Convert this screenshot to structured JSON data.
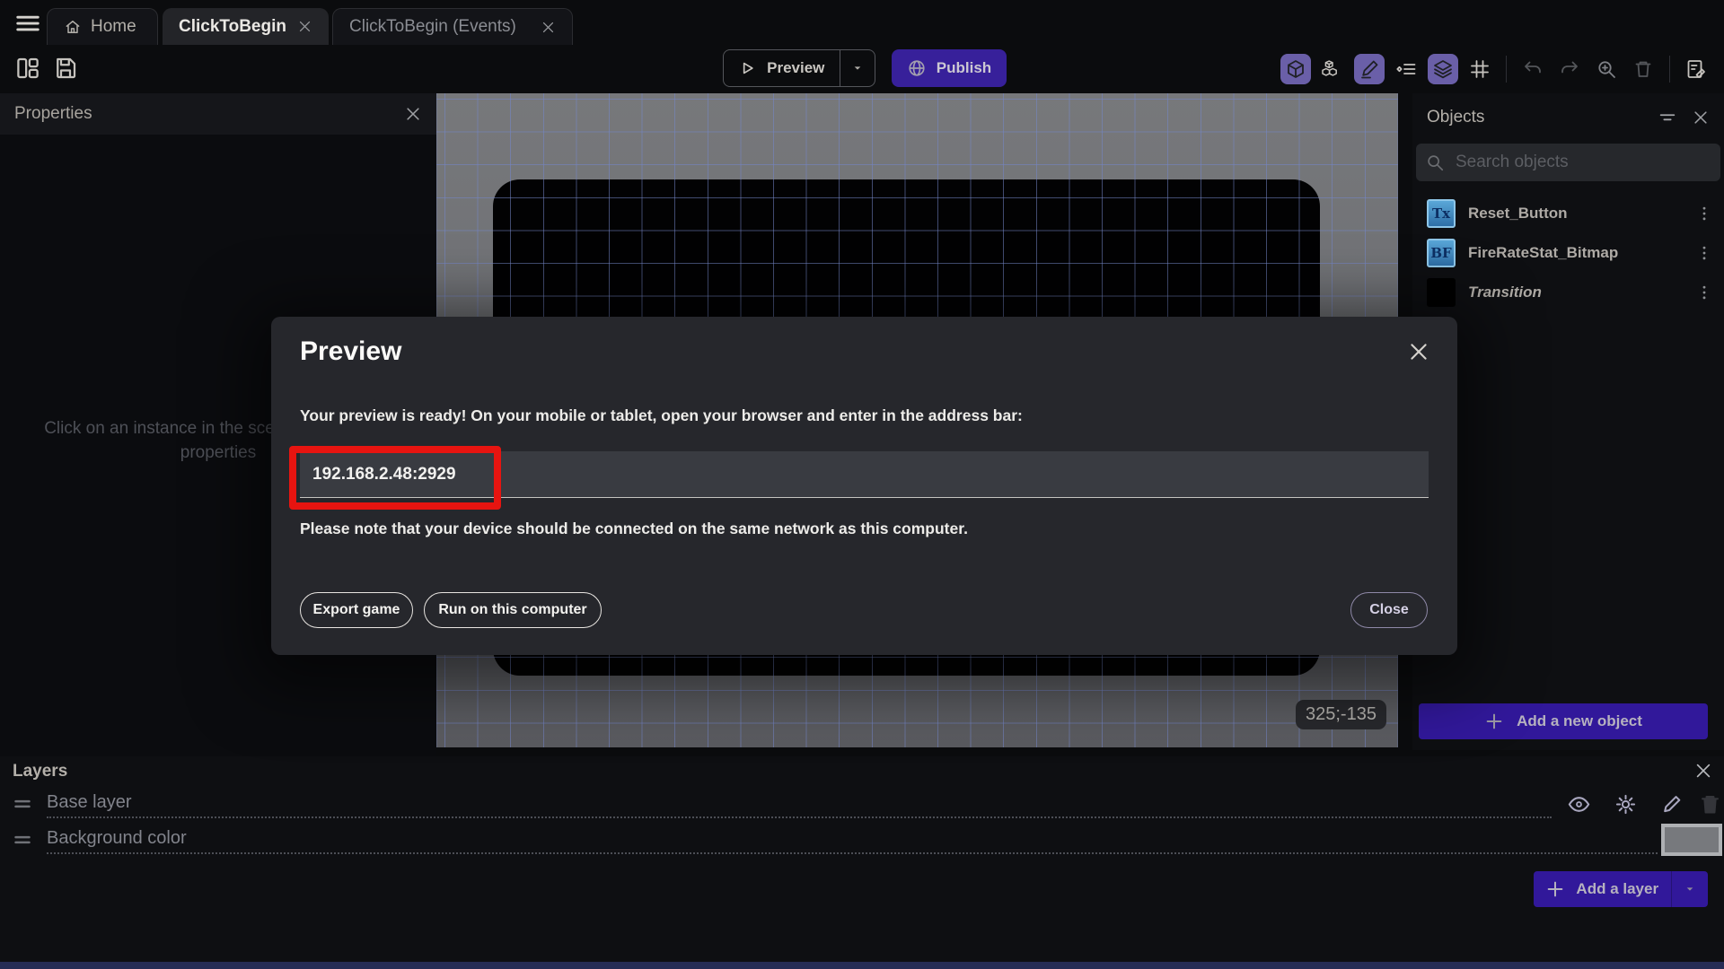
{
  "tab_bar": {
    "tabs": [
      {
        "label": "Home"
      },
      {
        "label": "ClickToBegin",
        "active": true
      },
      {
        "label": "ClickToBegin (Events)"
      }
    ]
  },
  "toolbar": {
    "preview_label": "Preview",
    "publish_label": "Publish"
  },
  "properties_panel": {
    "title": "Properties",
    "empty_message": "Click on an instance in the scene to display its properties"
  },
  "canvas": {
    "coordinates_badge": "325;-135"
  },
  "objects_panel": {
    "title": "Objects",
    "search_placeholder": "Search objects",
    "items": [
      {
        "name": "Reset_Button",
        "icon_text": "Tx"
      },
      {
        "name": "FireRateStat_Bitmap",
        "icon_text": "BF"
      },
      {
        "name": "Transition",
        "icon_text": ""
      }
    ],
    "add_button_label": "Add a new object"
  },
  "layers_panel": {
    "title": "Layers",
    "layers": [
      {
        "name": "Base layer"
      },
      {
        "name": "Background color"
      }
    ],
    "add_button_label": "Add a layer"
  },
  "preview_dialog": {
    "title": "Preview",
    "message": "Your preview is ready! On your mobile or tablet, open your browser and enter in the address bar:",
    "address": "192.168.2.48:2929",
    "note": "Please note that your device should be connected on the same network as this computer.",
    "export_button_label": "Export game",
    "run_button_label": "Run on this computer",
    "close_button_label": "Close"
  },
  "colors": {
    "accent_purple": "#37209a",
    "active_icon_bg": "#6a5fa8",
    "annotation_red": "#e71410",
    "object_icon_blue": "#3d8dc6",
    "canvas_gray": "#6f7175",
    "grid_blue": "#7486c8"
  },
  "icons": {
    "hamburger-icon": "three horizontal lines",
    "home-icon": "house outline",
    "close-icon": "x cross",
    "panels-icon": "split layout rectangles",
    "save-icon": "floppy disk",
    "play-icon": "triangle outline",
    "chevron-down-icon": "filled down caret",
    "globe-icon": "circle with meridians",
    "cube-3d-icon": "3d cube",
    "objects-icon": "stacked cubes",
    "pencil-icon": "pencil with baseline",
    "instances-list-icon": "diamond with list lines",
    "layers-icon": "stacked sheets",
    "grid-icon": "hash grid",
    "undo-icon": "curved arrow left",
    "redo-icon": "curved arrow right",
    "zoom-in-icon": "magnifier with plus",
    "trash-icon": "trash can",
    "events-sheet-icon": "sheet with pencil",
    "search-icon": "magnifier",
    "filter-icon": "shrinking lines",
    "kebab-icon": "three vertical dots",
    "drag-handle-icon": "two thick lines",
    "eye-icon": "eye",
    "effects-icon": "sun rays",
    "plus-icon": "plus sign"
  }
}
